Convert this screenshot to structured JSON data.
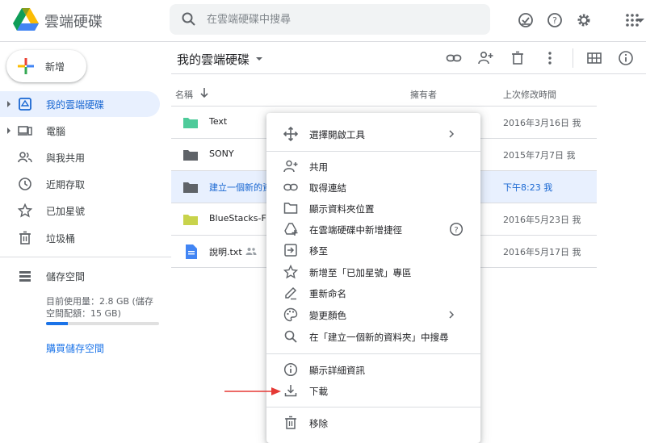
{
  "app": {
    "name": "雲端硬碟"
  },
  "search": {
    "placeholder": "在雲端硬碟中搜尋"
  },
  "top_icons": [
    "offline-check-icon",
    "help-icon",
    "settings-icon",
    "apps-grid-icon"
  ],
  "new_button": {
    "label": "新增"
  },
  "sidebar": {
    "items": [
      {
        "label": "我的雲端硬碟",
        "icon": "my-drive-icon",
        "active": true,
        "expandable": true
      },
      {
        "label": "電腦",
        "icon": "computer-icon",
        "active": false,
        "expandable": true
      },
      {
        "label": "與我共用",
        "icon": "shared-people-icon",
        "active": false,
        "expandable": false
      },
      {
        "label": "近期存取",
        "icon": "clock-icon",
        "active": false,
        "expandable": false
      },
      {
        "label": "已加星號",
        "icon": "star-icon",
        "active": false,
        "expandable": false
      },
      {
        "label": "垃圾桶",
        "icon": "trash-icon",
        "active": false,
        "expandable": false
      }
    ],
    "storage": {
      "label": "儲存空間",
      "usage_text": "目前使用量：2.8 GB (儲存空間配額：15 GB)",
      "used_fraction": 0.19,
      "buy_label": "購買儲存空間"
    }
  },
  "main": {
    "breadcrumb": "我的雲端硬碟",
    "toolbar_icons": [
      "get-link-icon",
      "share-icon",
      "delete-icon",
      "more-vert-icon",
      "grid-view-icon",
      "info-icon"
    ],
    "columns": {
      "name": "名稱",
      "owner": "擁有者",
      "modified": "上次修改時間"
    },
    "files": [
      {
        "name": "Text",
        "type": "folder",
        "color": "#4ecb9a",
        "modified": "2016年3月16日 我",
        "selected": false
      },
      {
        "name": "SONY",
        "type": "folder",
        "color": "#5f6368",
        "modified": "2015年7月7日 我",
        "selected": false
      },
      {
        "name": "建立一個新的資",
        "type": "folder",
        "color": "#5f6368",
        "modified": "下午8:23 我",
        "selected": true
      },
      {
        "name": "BlueStacks-Fix",
        "type": "folder",
        "color": "#c8d34b",
        "modified": "2016年5月23日 我",
        "selected": false
      },
      {
        "name": "說明.txt",
        "type": "doc",
        "color": "#4285f4",
        "modified": "2016年5月17日 我",
        "selected": false,
        "shared": true
      }
    ]
  },
  "context_menu": {
    "groups": [
      [
        {
          "label": "選擇開啟工具",
          "icon": "open-with-icon",
          "submenu": true
        }
      ],
      [
        {
          "label": "共用",
          "icon": "share-person-add-icon"
        },
        {
          "label": "取得連結",
          "icon": "link-icon"
        },
        {
          "label": "顯示資料夾位置",
          "icon": "folder-outline-icon"
        },
        {
          "label": "在雲端硬碟中新增捷徑",
          "icon": "add-shortcut-icon",
          "help": true
        },
        {
          "label": "移至",
          "icon": "move-to-icon"
        },
        {
          "label": "新增至「已加星號」專區",
          "icon": "star-outline-icon"
        },
        {
          "label": "重新命名",
          "icon": "rename-pencil-icon"
        },
        {
          "label": "變更顏色",
          "icon": "palette-icon",
          "submenu": true
        },
        {
          "label": "在「建立一個新的資料夾」中搜尋",
          "icon": "search-in-folder-icon"
        }
      ],
      [
        {
          "label": "顯示詳細資訊",
          "icon": "info-outline-icon"
        },
        {
          "label": "下載",
          "icon": "download-icon"
        }
      ],
      [
        {
          "label": "移除",
          "icon": "remove-trash-icon"
        }
      ]
    ]
  },
  "colors": {
    "accent": "#1a73e8",
    "selected_bg": "#e8f0fe",
    "annotation_arrow": "#e53935"
  }
}
